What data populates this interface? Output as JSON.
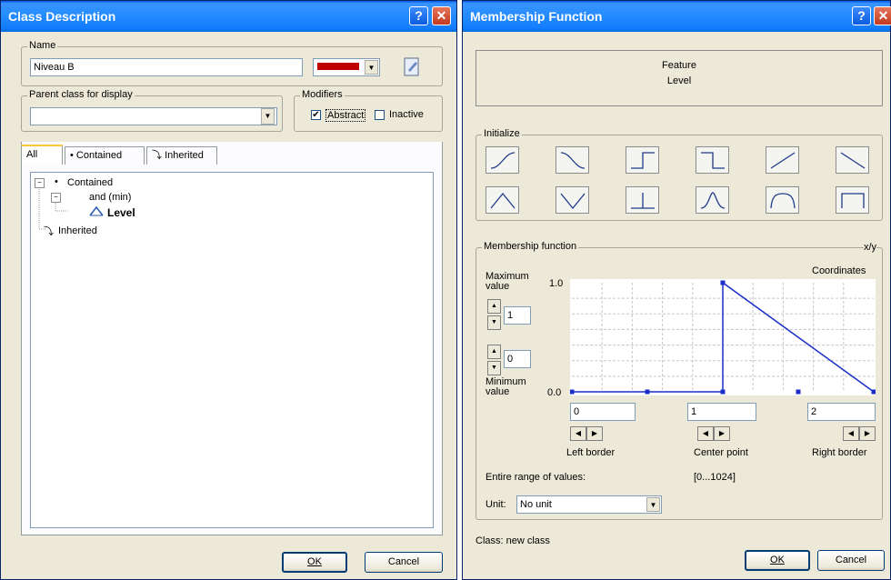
{
  "left_window": {
    "title": "Class Description",
    "name_group": {
      "label": "Name",
      "value": "Niveau B",
      "color": "#c00000"
    },
    "parent_group": {
      "label": "Parent class for display",
      "value": ""
    },
    "modifiers_group": {
      "label": "Modifiers",
      "abstract_label": "Abstract",
      "abstract_checked": true,
      "inactive_label": "Inactive",
      "inactive_checked": false
    },
    "tabs": [
      "All",
      "Contained",
      "Inherited"
    ],
    "tree": {
      "contained": "Contained",
      "and_min": "and (min)",
      "level": "Level",
      "inherited": "Inherited"
    },
    "ok_label": "OK",
    "cancel_label": "Cancel"
  },
  "right_window": {
    "title": "Membership Function",
    "feature_label": "Feature",
    "feature_value": "Level",
    "initialize_label": "Initialize",
    "initialize_icons": [
      "s-curve-icon",
      "z-curve-icon",
      "step-up-icon",
      "step-down-icon",
      "linear-up-icon",
      "linear-down-icon",
      "triangle-icon",
      "v-shape-icon",
      "singleton-icon",
      "gaussian-icon",
      "bell-icon",
      "rectangle-icon"
    ],
    "mf_group_label": "Membership function",
    "xy_label": "x/y",
    "coordinates_label": "Coordinates",
    "max_label": "Maximum value",
    "max_value": "1",
    "min_value": "0",
    "min_label": "Minimum value",
    "y_top": "1.0",
    "y_bottom": "0.0",
    "left_border_value": "0",
    "center_point_value": "1",
    "right_border_value": "2",
    "left_border_label": "Left border",
    "center_point_label": "Center point",
    "right_border_label": "Right border",
    "range_label": "Entire range of values:",
    "range_value": "[0...1024]",
    "unit_label": "Unit:",
    "unit_value": "No unit",
    "class_label": "Class: new class",
    "ok_label": "OK",
    "cancel_label": "Cancel"
  },
  "chart_data": {
    "type": "line",
    "x": [
      0,
      1,
      1,
      2
    ],
    "y": [
      0,
      0,
      1,
      0
    ],
    "xlim": [
      0,
      2
    ],
    "ylim": [
      0,
      1
    ],
    "grid": true
  }
}
